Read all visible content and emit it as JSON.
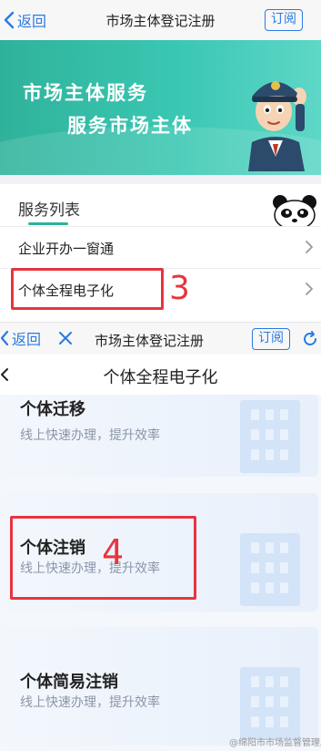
{
  "top_nav": {
    "back_label": "返回",
    "title": "市场主体登记注册",
    "subscribe_label": "订阅"
  },
  "banner": {
    "line1": "市场主体服务",
    "line2": "服务市场主体"
  },
  "service_list": {
    "title": "服务列表",
    "items": [
      {
        "label": "企业开办一窗通"
      },
      {
        "label": "个体全程电子化"
      }
    ]
  },
  "annotations": {
    "step3": "3",
    "step4": "4"
  },
  "second_nav": {
    "back_label": "返回",
    "title": "市场主体登记注册",
    "subscribe_label": "订阅"
  },
  "page_header": {
    "title": "个体全程电子化"
  },
  "cards": [
    {
      "title": "个体迁移",
      "subtitle": "线上快速办理，提升效率"
    },
    {
      "title": "个体注销",
      "subtitle": "线上快速办理，提升效率"
    },
    {
      "title": "个体简易注销",
      "subtitle": "线上快速办理，提升效率"
    }
  ],
  "watermark": "@绵阳市市场监督管理局",
  "colors": {
    "accent_blue": "#2a7ae2",
    "banner_teal": "#2fb29b",
    "annotation_red": "#e8343f"
  },
  "icons": [
    "chevron-left-icon",
    "close-icon",
    "reload-icon",
    "chevron-right-icon",
    "building-icon",
    "police-mascot",
    "panda-mascot"
  ]
}
